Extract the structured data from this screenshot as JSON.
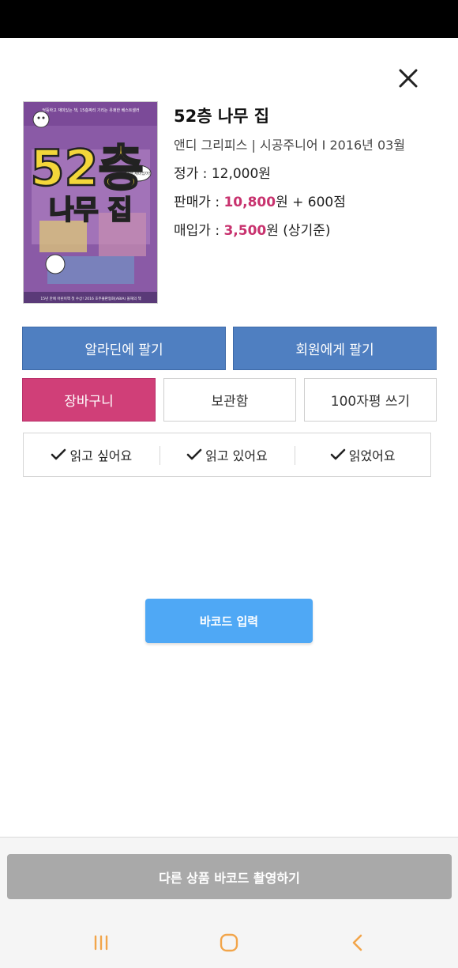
{
  "book": {
    "title": "52층 나무 집",
    "meta": "앤디 그리피스 | 시공주니어 I 2016년 03월",
    "list_price_label": "정가 : ",
    "list_price": "12,000원",
    "sale_label": "판매가 : ",
    "sale_price": "10,800",
    "sale_suffix": "원 + 600점",
    "buy_label": "매입가 : ",
    "buy_price": "3,500",
    "buy_suffix": "원 (상기준)",
    "cover": {
      "title_big": "52층",
      "title_sub": "나무 집",
      "top_caption": "엉뚱하고 재미있는 책, 15층짜리 기리는 유쾌한 베스트셀러",
      "bottom_caption": "15년 만에 어린이책 첫 수상! 2016 호주출판협회(ABIA) 올해의 책",
      "bubble_text": "너무 재미있어!",
      "background_color": "#8a5aa6",
      "title_color": "#f3d63a"
    }
  },
  "actions": {
    "sell_aladin": "알라딘에 팔기",
    "sell_member": "회원에게 팔기",
    "cart": "장바구니",
    "storage": "보관함",
    "review": "100자평 쓰기"
  },
  "reading": {
    "want": "읽고 싶어요",
    "reading": "읽고 있어요",
    "read": "읽었어요"
  },
  "barcode_button": "바코드 입력",
  "scan_button": "다른 상품 바코드 촬영하기",
  "colors": {
    "accent_pink": "#d03f78",
    "price_accent": "#c8326e",
    "blue_button": "#4f7fc1",
    "barcode_blue": "#4fa8f5",
    "disabled_gray": "#a9a9a9",
    "nav_icon": "#f2a54a"
  },
  "nav": {
    "recents_icon": "recents-icon",
    "home_icon": "home-icon",
    "back_icon": "back-icon"
  }
}
